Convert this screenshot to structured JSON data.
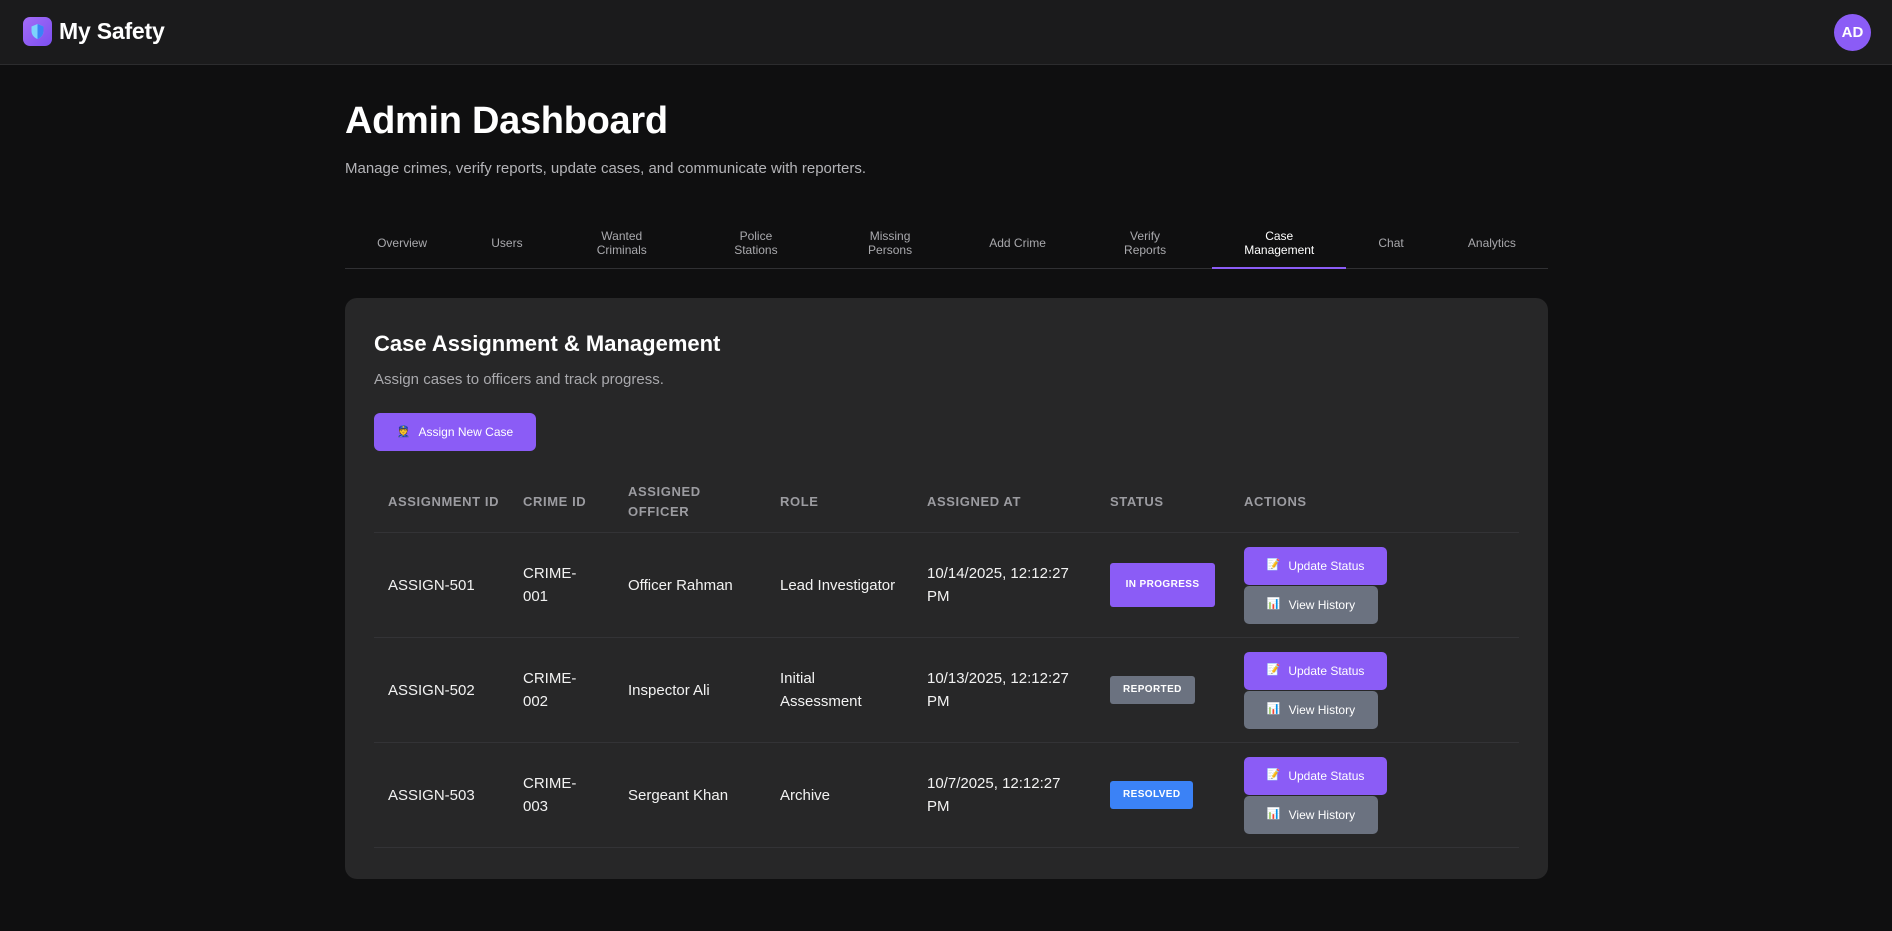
{
  "app": {
    "title": "My Safety",
    "avatar_initials": "AD",
    "accent_color": "#8b5cf6"
  },
  "page": {
    "title": "Admin Dashboard",
    "subtitle": "Manage crimes, verify reports, update cases, and communicate with reporters."
  },
  "tabs": [
    {
      "label": "Overview",
      "active": false
    },
    {
      "label": "Users",
      "active": false
    },
    {
      "label": "Wanted Criminals",
      "active": false
    },
    {
      "label": "Police Stations",
      "active": false
    },
    {
      "label": "Missing Persons",
      "active": false
    },
    {
      "label": "Add Crime",
      "active": false
    },
    {
      "label": "Verify Reports",
      "active": false
    },
    {
      "label": "Case Management",
      "active": true
    },
    {
      "label": "Chat",
      "active": false
    },
    {
      "label": "Analytics",
      "active": false
    }
  ],
  "card": {
    "title": "Case Assignment & Management",
    "subtitle": "Assign cases to officers and track progress.",
    "assign_button": {
      "label": "Assign New Case",
      "icon": "officer-icon"
    }
  },
  "table": {
    "columns": [
      "Assignment ID",
      "Crime ID",
      "Assigned Officer",
      "Role",
      "Assigned At",
      "Status",
      "Actions"
    ],
    "rows": [
      {
        "assignment_id": "ASSIGN-501",
        "crime_id": [
          "CRIME-",
          "001"
        ],
        "officer": "Officer Rahman",
        "role": [
          "Lead Investigator"
        ],
        "assigned_at": [
          "10/14/2025, 12:12:27",
          "PM"
        ],
        "status": "In Progress",
        "status_color": "#8b5cf6"
      },
      {
        "assignment_id": "ASSIGN-502",
        "crime_id": [
          "CRIME-",
          "002"
        ],
        "officer": "Inspector Ali",
        "role": [
          "Initial",
          "Assessment"
        ],
        "assigned_at": [
          "10/13/2025, 12:12:27",
          "PM"
        ],
        "status": "Reported",
        "status_color": "#6b7280"
      },
      {
        "assignment_id": "ASSIGN-503",
        "crime_id": [
          "CRIME-",
          "003"
        ],
        "officer": "Sergeant Khan",
        "role": [
          "Archive"
        ],
        "assigned_at": [
          "10/7/2025, 12:12:27",
          "PM"
        ],
        "status": "Resolved",
        "status_color": "#3b82f6"
      }
    ],
    "actions": {
      "update_label": "Update Status",
      "update_icon": "memo-icon",
      "history_label": "View History",
      "history_icon": "bar-chart-icon"
    }
  }
}
